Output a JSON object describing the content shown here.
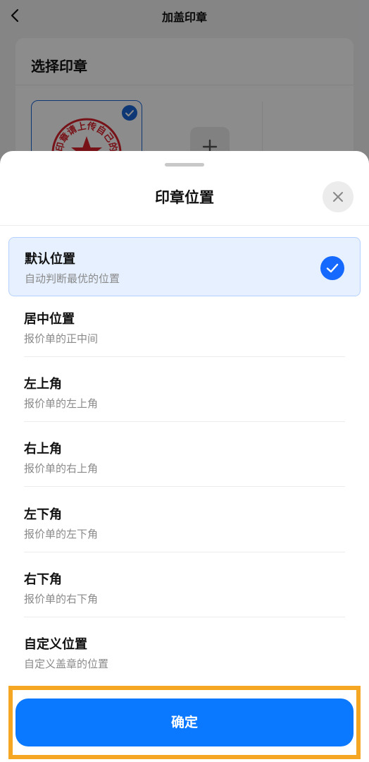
{
  "header": {
    "title": "加盖印章",
    "back_icon": "chevron-left-icon"
  },
  "seal_card": {
    "title": "选择印章",
    "seal_text": "印章请上传自己的",
    "add_icon": "plus-icon"
  },
  "sheet": {
    "title": "印章位置",
    "close_icon": "close-icon",
    "options": [
      {
        "title": "默认位置",
        "desc": "自动判断最优的位置",
        "selected": true
      },
      {
        "title": "居中位置",
        "desc": "报价单的正中间",
        "selected": false
      },
      {
        "title": "左上角",
        "desc": "报价单的左上角",
        "selected": false
      },
      {
        "title": "右上角",
        "desc": "报价单的右上角",
        "selected": false
      },
      {
        "title": "左下角",
        "desc": "报价单的左下角",
        "selected": false
      },
      {
        "title": "右下角",
        "desc": "报价单的右下角",
        "selected": false
      },
      {
        "title": "自定义位置",
        "desc": "自定义盖章的位置",
        "selected": false
      }
    ],
    "confirm_label": "确定"
  },
  "colors": {
    "accent": "#0a78ff",
    "check": "#1669ff",
    "seal_red": "#d9232d",
    "highlight_border": "#f5a623",
    "selected_bg": "#e6f0ff"
  }
}
